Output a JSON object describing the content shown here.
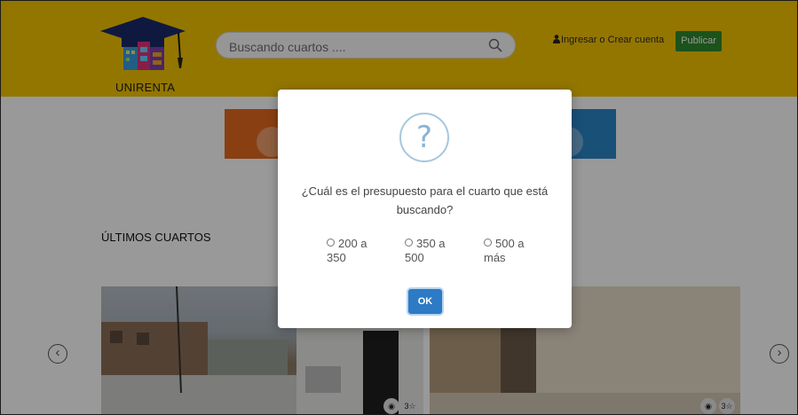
{
  "header": {
    "logo_text": "UNIRENTA",
    "search_placeholder": "Buscando cuartos ....",
    "account_link": "Ingresar o Crear cuenta",
    "publish_button": "Publicar",
    "colors": {
      "header_bg": "#f5c500",
      "publish_bg": "#2e8b2e"
    }
  },
  "main": {
    "section_title": "ÚLTIMOS CUARTOS",
    "listings": [
      {
        "badge_count": "3"
      },
      {
        "badge_count": "3"
      }
    ],
    "icons": {
      "prev": "chevron-left-icon",
      "next": "chevron-right-icon",
      "views": "binoculars-icon",
      "rating": "star-icon"
    }
  },
  "modal": {
    "icon": "?",
    "question": "¿Cuál es el presupuesto para el cuarto que está buscando?",
    "options": [
      {
        "label": "200 a 350"
      },
      {
        "label": "350 a 500"
      },
      {
        "label": "500 a más"
      }
    ],
    "ok_button": "OK",
    "colors": {
      "ok_bg": "#2d7ac5",
      "icon_ring": "#a7c7dd"
    }
  }
}
